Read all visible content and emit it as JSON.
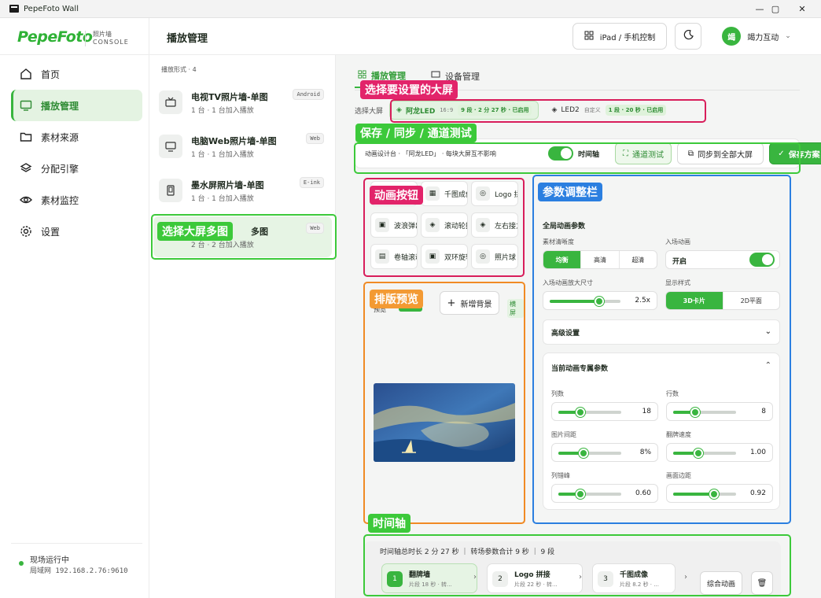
{
  "window": {
    "title": "PepeFoto Wall",
    "minimize": "—",
    "maximize": "▢",
    "close": "✕"
  },
  "brand": {
    "logo": "PepeFoto",
    "sub1": "照片墙",
    "sub2": "CONSOLE"
  },
  "nav": {
    "items": [
      {
        "label": "首页",
        "icon": "home-icon"
      },
      {
        "label": "播放管理",
        "icon": "monitor-icon"
      },
      {
        "label": "素材来源",
        "icon": "folder-icon"
      },
      {
        "label": "分配引擎",
        "icon": "layers-icon"
      },
      {
        "label": "素材监控",
        "icon": "eye-icon"
      },
      {
        "label": "设置",
        "icon": "gear-icon"
      }
    ]
  },
  "status": {
    "title": "现场运行中",
    "address": "局域网 192.168.2.76:9610"
  },
  "header": {
    "title": "播放管理",
    "control": "iPad / 手机控制",
    "user_initial": "竭",
    "user_name": "竭力互动"
  },
  "list": {
    "heading": "播放形式 · 4",
    "items": [
      {
        "title": "电视TV照片墙-单图",
        "sub": "1 台 · 1 台加入播放",
        "tag": "Android"
      },
      {
        "title": "电脑Web照片墙-单图",
        "sub": "1 台 · 1 台加入播放",
        "tag": "Web"
      },
      {
        "title": "墨水屏照片墙-单图",
        "sub": "1 台 · 1 台加入播放",
        "tag": "E-ink"
      },
      {
        "title": "多图",
        "sub": "2 台 · 2 台加入播放",
        "tag": "Web"
      }
    ]
  },
  "tabs": [
    "播放管理",
    "设备管理"
  ],
  "screen_select": {
    "label": "选择大屏",
    "screens": [
      {
        "name": "阿龙LED",
        "ratio": "16:9",
        "pill": "9 段 · 2 分 27 秒 · 已启用"
      },
      {
        "name": "LED2",
        "ratio": "自定义",
        "pill": "1 段 · 20 秒 · 已启用"
      }
    ]
  },
  "toolbar": {
    "text": "动画设计台 · 「阿龙LED」 · 每块大屏互不影响",
    "timeline_label": "时间轴",
    "test": "通道测试",
    "sync": "同步到全部大屏",
    "save": "保存方案"
  },
  "anim_buttons": [
    "",
    "千图成像",
    "Logo 拼",
    "波浪弹出",
    "滚动轮播",
    "左右接力",
    "卷轴滚动",
    "双环旋转",
    "照片球"
  ],
  "preview": {
    "add_bg": "新增背景",
    "label": "预览",
    "tag": "横屏"
  },
  "params": {
    "global_title": "全局动画参数",
    "clarity_label": "素材清晰度",
    "clarity_opts": [
      "均衡",
      "高清",
      "超清"
    ],
    "entry_label": "入场动画",
    "entry_value": "开启",
    "zoom_label": "入场动画放大尺寸",
    "zoom_value": "2.5x",
    "zoom_level": 0.7,
    "style_label": "显示样式",
    "style_opts": [
      "3D卡片",
      "2D平面"
    ],
    "advanced": "高级设置",
    "current": "当前动画专属参数",
    "fields": [
      {
        "label": "列数",
        "value": "18",
        "level": 0.35
      },
      {
        "label": "行数",
        "value": "8",
        "level": 0.35
      },
      {
        "label": "图片间距",
        "value": "8%",
        "level": 0.4
      },
      {
        "label": "翻牌速度",
        "value": "1.00",
        "level": 0.4
      },
      {
        "label": "列错峰",
        "value": "0.60",
        "level": 0.35
      },
      {
        "label": "画面边距",
        "value": "0.92",
        "level": 0.65
      }
    ]
  },
  "timeline": {
    "summary": "时间轴总时长 2 分 27 秒 ｜ 转场参数合计 9 秒 ｜ 9 段",
    "steps": [
      {
        "num": "1",
        "title": "翻牌墙",
        "sub": "片段 18 秒 · 转..."
      },
      {
        "num": "2",
        "title": "Logo 拼接",
        "sub": "片段 22 秒 · 转..."
      },
      {
        "num": "3",
        "title": "千图成像",
        "sub": "片段 8.2 秒 · ..."
      }
    ],
    "combo": "综合动画"
  },
  "annotations": {
    "select_screen": "选择要设置的大屏",
    "save_sync": "保存 / 同步 / 通道测试",
    "anim_buttons": "动画按钮",
    "params": "参数调整栏",
    "select_multi": "选择大屏多图",
    "layout_preview": "排版预览",
    "timeline": "时间轴"
  }
}
